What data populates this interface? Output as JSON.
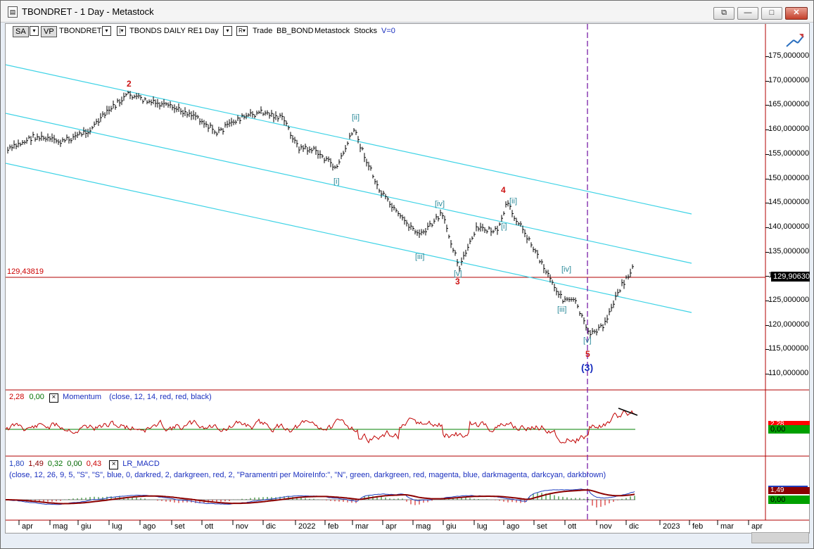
{
  "window": {
    "title": "TBONDRET - 1 Day - Metastock",
    "buttons": {
      "restore": "⧉",
      "minimize": "—",
      "maximize": "□",
      "close": "✕"
    }
  },
  "toolbar": {
    "sa": "SA",
    "vp": "VP",
    "symbol": "TBONDRET",
    "security_name": "TBONDS DAILY RE",
    "period": "1 Day",
    "r_label": "R",
    "trade": "Trade",
    "account": "BB_BOND",
    "source": "Metastock",
    "category": "Stocks",
    "volume": "V=0"
  },
  "price_scale": {
    "ticks": [
      "175,000000",
      "170,000000",
      "165,000000",
      "160,000000",
      "155,000000",
      "150,000000",
      "145,000000",
      "140,000000",
      "135,000000",
      "130,000000",
      "125,000000",
      "120,000000",
      "115,000000",
      "110,000000"
    ],
    "last_price": "129,90630",
    "ref_price": "129,43819"
  },
  "waves": {
    "w2": "2",
    "w3": "3",
    "w4": "4",
    "w5": "5",
    "big3": "(3)",
    "i": "[i]",
    "ii": "[ii]",
    "iii": "[iii]",
    "iv": "[iv]",
    "v": "[v]",
    "ii_b": "[ii]",
    "i_b": "[i]",
    "iii_b": "[iii]",
    "iv_b": "[iv]",
    "v_b": "[v]"
  },
  "momentum": {
    "value_red": "2,28",
    "value_green": "0,00",
    "name": "Momentum",
    "params": "(close,  12,  14,  red,  red,  black)",
    "badge_top": "2,28",
    "badge_bottom": "0,00"
  },
  "macd": {
    "values": [
      {
        "text": "1,80",
        "color": "#1f3fbf"
      },
      {
        "text": "1,49",
        "color": "#8b0000"
      },
      {
        "text": "0,32",
        "color": "#007000"
      },
      {
        "text": "0,00",
        "color": "#006400"
      },
      {
        "text": "0,43",
        "color": "#cc0000"
      }
    ],
    "name": "LR_MACD",
    "params": "(close,  12,  26,  9,  5,  \"S\",  \"S\",  blue,  0,  darkred,  2,  darkgreen,  red,  2,  \"Paramentri per MoireInfo:\",  \"N\",  green,  darkgreen,  red,  magenta,  blue,  darkmagenta,  darkcyan,  darkbrown)",
    "badge_top": "1,49",
    "badge_bottom": "0,00"
  },
  "time_axis": [
    "apr",
    "mag",
    "giu",
    "lug",
    "ago",
    "set",
    "ott",
    "nov",
    "dic",
    "2022",
    "feb",
    "mar",
    "apr",
    "mag",
    "giu",
    "lug",
    "ago",
    "set",
    "ott",
    "nov",
    "dic",
    "2023",
    "feb",
    "mar",
    "apr"
  ],
  "colors": {
    "channel": "#3fd3e6",
    "bars": "#000000",
    "wave_red": "#cc1111",
    "wave_teal": "#2a8a9a",
    "wave_blue": "#1a2fbf",
    "divider_red": "#b00000",
    "cursor": "#7a1fa8"
  },
  "icons": {
    "draw_tool": "trend-pen-icon"
  }
}
